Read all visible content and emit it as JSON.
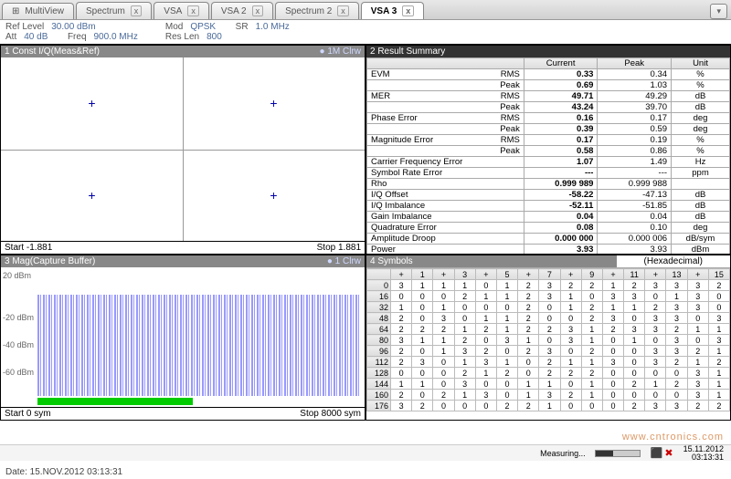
{
  "tabs": {
    "multiview": "MultiView",
    "list": [
      "Spectrum",
      "VSA",
      "VSA 2",
      "Spectrum 2",
      "VSA 3"
    ],
    "activeIdx": 4,
    "dropdown": "▾"
  },
  "params": {
    "ref_lbl": "Ref Level",
    "ref_val": "30.00 dBm",
    "att_lbl": "Att",
    "att_val": "40 dB",
    "freq_lbl": "Freq",
    "freq_val": "900.0 MHz",
    "mod_lbl": "Mod",
    "mod_val": "QPSK",
    "sr_lbl": "SR",
    "sr_val": "1.0 MHz",
    "rlen_lbl": "Res Len",
    "rlen_val": "800"
  },
  "p1": {
    "title": "1 Const I/Q(Meas&Ref)",
    "trace": "● 1M Clrw",
    "start": "Start -1.881",
    "stop": "Stop 1.881"
  },
  "p2": {
    "title": "2 Result Summary",
    "cols": [
      "",
      "Current",
      "Peak",
      "Unit"
    ],
    "rows": [
      {
        "l": "EVM",
        "s": "RMS",
        "c": "0.33",
        "p": "0.34",
        "u": "%"
      },
      {
        "l": "",
        "s": "Peak",
        "c": "0.69",
        "p": "1.03",
        "u": "%"
      },
      {
        "l": "MER",
        "s": "RMS",
        "c": "49.71",
        "p": "49.29",
        "u": "dB"
      },
      {
        "l": "",
        "s": "Peak",
        "c": "43.24",
        "p": "39.70",
        "u": "dB"
      },
      {
        "l": "Phase Error",
        "s": "RMS",
        "c": "0.16",
        "p": "0.17",
        "u": "deg"
      },
      {
        "l": "",
        "s": "Peak",
        "c": "0.39",
        "p": "0.59",
        "u": "deg"
      },
      {
        "l": "Magnitude Error",
        "s": "RMS",
        "c": "0.17",
        "p": "0.19",
        "u": "%"
      },
      {
        "l": "",
        "s": "Peak",
        "c": "0.58",
        "p": "0.86",
        "u": "%"
      },
      {
        "l": "Carrier Frequency Error",
        "s": "",
        "c": "1.07",
        "p": "1.49",
        "u": "Hz"
      },
      {
        "l": "Symbol Rate Error",
        "s": "",
        "c": "---",
        "p": "---",
        "u": "ppm"
      },
      {
        "l": "Rho",
        "s": "",
        "c": "0.999 989",
        "p": "0.999 988",
        "u": ""
      },
      {
        "l": "I/Q Offset",
        "s": "",
        "c": "-58.22",
        "p": "-47.13",
        "u": "dB"
      },
      {
        "l": "I/Q Imbalance",
        "s": "",
        "c": "-52.11",
        "p": "-51.85",
        "u": "dB"
      },
      {
        "l": "Gain Imbalance",
        "s": "",
        "c": "0.04",
        "p": "0.04",
        "u": "dB"
      },
      {
        "l": "Quadrature Error",
        "s": "",
        "c": "0.08",
        "p": "0.10",
        "u": "deg"
      },
      {
        "l": "Amplitude Droop",
        "s": "",
        "c": "0.000 000",
        "p": "0.000 006",
        "u": "dB/sym"
      },
      {
        "l": "Power",
        "s": "",
        "c": "3.93",
        "p": "3.93",
        "u": "dBm"
      }
    ]
  },
  "p3": {
    "title": "3 Mag(Capture Buffer)",
    "trace": "● 1 Clrw",
    "axis": [
      "20 dBm",
      "-20 dBm",
      "-40 dBm",
      "-60 dBm"
    ],
    "start": "Start 0 sym",
    "stop": "Stop 8000 sym"
  },
  "p4": {
    "title": "4 Symbols",
    "mode": "(Hexadecimal)",
    "cols": [
      "+",
      "1",
      "+",
      "3",
      "+",
      "5",
      "+",
      "7",
      "+",
      "9",
      "+",
      "11",
      "+",
      "13",
      "+",
      "15"
    ],
    "rows": [
      {
        "h": "0",
        "c": [
          "3",
          "1",
          "1",
          "1",
          "0",
          "1",
          "2",
          "3",
          "2",
          "2",
          "1",
          "2",
          "3",
          "3",
          "3",
          "2"
        ]
      },
      {
        "h": "16",
        "c": [
          "0",
          "0",
          "0",
          "2",
          "1",
          "1",
          "2",
          "3",
          "1",
          "0",
          "3",
          "3",
          "0",
          "1",
          "3",
          "0"
        ]
      },
      {
        "h": "32",
        "c": [
          "1",
          "0",
          "1",
          "0",
          "0",
          "0",
          "2",
          "0",
          "1",
          "2",
          "1",
          "1",
          "2",
          "3",
          "3",
          "0"
        ]
      },
      {
        "h": "48",
        "c": [
          "2",
          "0",
          "3",
          "0",
          "1",
          "1",
          "2",
          "0",
          "0",
          "2",
          "3",
          "0",
          "3",
          "3",
          "0",
          "3"
        ]
      },
      {
        "h": "64",
        "c": [
          "2",
          "2",
          "2",
          "1",
          "2",
          "1",
          "2",
          "2",
          "3",
          "1",
          "2",
          "3",
          "3",
          "2",
          "1",
          "1"
        ]
      },
      {
        "h": "80",
        "c": [
          "3",
          "1",
          "1",
          "2",
          "0",
          "3",
          "1",
          "0",
          "3",
          "1",
          "0",
          "1",
          "0",
          "3",
          "0",
          "3"
        ]
      },
      {
        "h": "96",
        "c": [
          "2",
          "0",
          "1",
          "3",
          "2",
          "0",
          "2",
          "3",
          "0",
          "2",
          "0",
          "0",
          "3",
          "3",
          "2",
          "1"
        ]
      },
      {
        "h": "112",
        "c": [
          "2",
          "3",
          "0",
          "1",
          "3",
          "1",
          "0",
          "2",
          "1",
          "1",
          "3",
          "0",
          "3",
          "2",
          "1",
          "2"
        ]
      },
      {
        "h": "128",
        "c": [
          "0",
          "0",
          "0",
          "2",
          "1",
          "2",
          "0",
          "2",
          "2",
          "2",
          "0",
          "0",
          "0",
          "0",
          "3",
          "1"
        ]
      },
      {
        "h": "144",
        "c": [
          "1",
          "1",
          "0",
          "3",
          "0",
          "0",
          "1",
          "1",
          "0",
          "1",
          "0",
          "2",
          "1",
          "2",
          "3",
          "1"
        ]
      },
      {
        "h": "160",
        "c": [
          "2",
          "0",
          "2",
          "1",
          "3",
          "0",
          "1",
          "3",
          "2",
          "1",
          "0",
          "0",
          "0",
          "0",
          "3",
          "1"
        ]
      },
      {
        "h": "176",
        "c": [
          "3",
          "2",
          "0",
          "0",
          "0",
          "2",
          "2",
          "1",
          "0",
          "0",
          "0",
          "2",
          "3",
          "3",
          "2",
          "2"
        ]
      }
    ]
  },
  "status": {
    "measuring": "Measuring...",
    "date": "15.11.2012",
    "time": "03:13:31"
  },
  "footer": "Date: 15.NOV.2012  03:13:31",
  "watermark": "www.cntronics.com",
  "chart_data": [
    {
      "type": "scatter",
      "title": "Const I/Q(Meas&Ref)",
      "xlim": [
        -1.881,
        1.881
      ],
      "ylim": [
        -1.881,
        1.881
      ],
      "series": [
        {
          "name": "1M Clrw",
          "points": [
            [
              -0.94,
              0.94
            ],
            [
              0.94,
              0.94
            ],
            [
              -0.94,
              -0.94
            ],
            [
              0.94,
              -0.94
            ]
          ]
        }
      ]
    },
    {
      "type": "line",
      "title": "Mag(Capture Buffer)",
      "xlabel": "sym",
      "ylabel": "dBm",
      "xlim": [
        0,
        8000
      ],
      "ylim": [
        -60,
        20
      ],
      "series": [
        {
          "name": "1 Clrw",
          "note": "noise floor approx -15 dBm mean with peaks to ~5 dBm across full span"
        }
      ]
    }
  ]
}
